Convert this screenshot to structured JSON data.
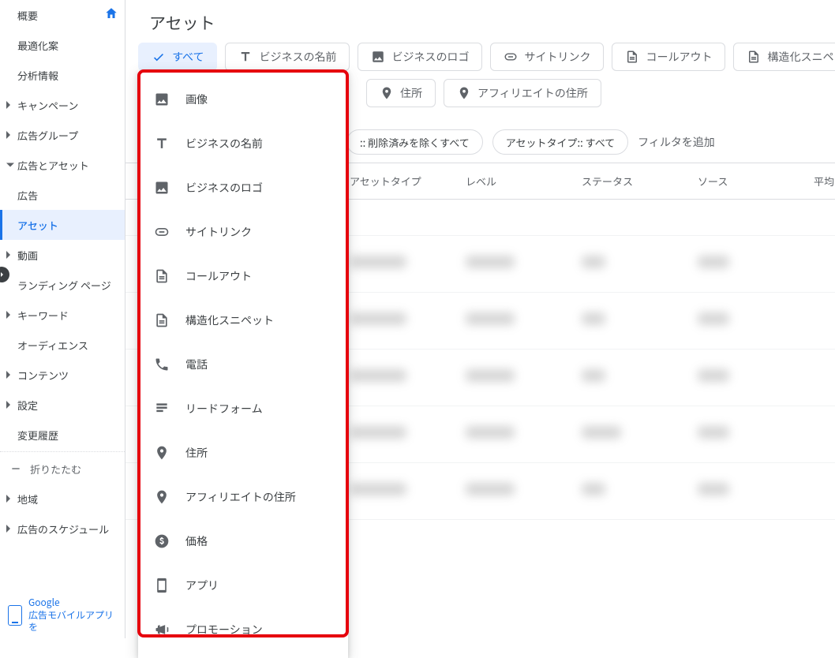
{
  "page_title": "アセット",
  "sidebar": {
    "items": [
      {
        "label": "概要",
        "home": true
      },
      {
        "label": "最適化案"
      },
      {
        "label": "分析情報"
      },
      {
        "label": "キャンペーン",
        "expandable": true
      },
      {
        "label": "広告グループ",
        "expandable": true
      },
      {
        "label": "広告とアセット",
        "expandable": true,
        "open": true,
        "children": [
          {
            "label": "広告"
          },
          {
            "label": "アセット",
            "active": true
          }
        ]
      },
      {
        "label": "動画",
        "expandable": true
      },
      {
        "label": "ランディング ページ"
      },
      {
        "label": "キーワード",
        "expandable": true
      },
      {
        "label": "オーディエンス"
      },
      {
        "label": "コンテンツ",
        "expandable": true
      },
      {
        "label": "設定",
        "expandable": true
      },
      {
        "label": "変更履歴"
      }
    ],
    "collapse_label": "折りたたむ",
    "below_items": [
      {
        "label": "地域",
        "expandable": true
      },
      {
        "label": "広告のスケジュール",
        "expandable": true
      }
    ],
    "mobile_promo_line1": "Google",
    "mobile_promo_line2": "広告モバイルアプリを"
  },
  "chips": [
    {
      "label": "すべて",
      "icon": "check",
      "active": true
    },
    {
      "label": "ビジネスの名前",
      "icon": "text"
    },
    {
      "label": "ビジネスのロゴ",
      "icon": "image"
    },
    {
      "label": "サイトリンク",
      "icon": "link"
    },
    {
      "label": "コールアウト",
      "icon": "snippet"
    },
    {
      "label": "構造化スニペット",
      "icon": "snippet"
    }
  ],
  "chips_row2": [
    {
      "label": "住所",
      "icon": "pin"
    },
    {
      "label": "アフィリエイトの住所",
      "icon": "pin"
    }
  ],
  "filters": {
    "pill1": ":: 削除済みを除くすべて",
    "pill2": "アセットタイプ:: すべて",
    "add": "フィルタを追加"
  },
  "table": {
    "headers": [
      "",
      "アセットタイプ",
      "レベル",
      "ステータス",
      "ソース",
      "平均"
    ]
  },
  "dropdown": [
    {
      "label": "画像",
      "icon": "image"
    },
    {
      "label": "ビジネスの名前",
      "icon": "text"
    },
    {
      "label": "ビジネスのロゴ",
      "icon": "image"
    },
    {
      "label": "サイトリンク",
      "icon": "link"
    },
    {
      "label": "コールアウト",
      "icon": "snippet"
    },
    {
      "label": "構造化スニペット",
      "icon": "snippet"
    },
    {
      "label": "電話",
      "icon": "phone"
    },
    {
      "label": "リードフォーム",
      "icon": "form"
    },
    {
      "label": "住所",
      "icon": "pin"
    },
    {
      "label": "アフィリエイトの住所",
      "icon": "pin"
    },
    {
      "label": "価格",
      "icon": "price"
    },
    {
      "label": "アプリ",
      "icon": "app"
    },
    {
      "label": "プロモーション",
      "icon": "promo"
    }
  ]
}
